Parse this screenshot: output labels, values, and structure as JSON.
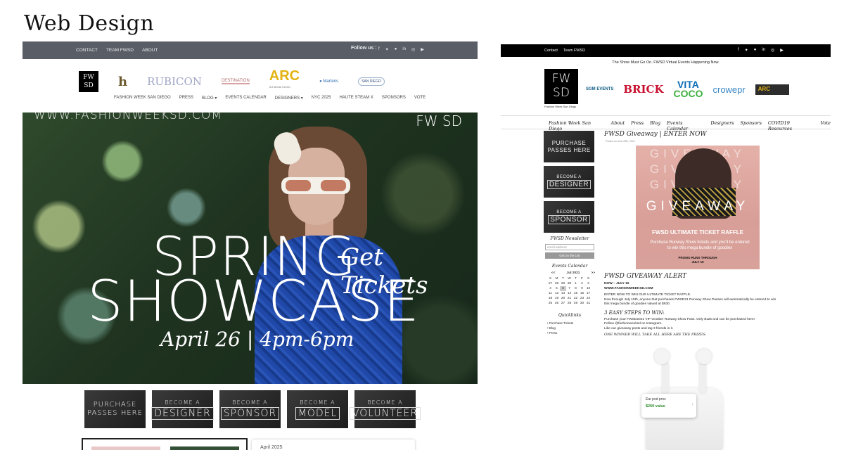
{
  "page_heading": "Web Design",
  "left_site": {
    "topbar": {
      "nav": [
        "CONTACT",
        "TEAM FWSD",
        "ABOUT"
      ],
      "follow_label": "Follow us :",
      "social_icons": [
        "facebook-icon",
        "twitter-icon",
        "pinterest-icon",
        "linkedin-icon",
        "instagram-icon",
        "youtube-icon"
      ]
    },
    "logos": {
      "fwsd": "FW SD",
      "h": "h",
      "rubicon": "RUBICON",
      "destination": "DESTINATION",
      "arc": "ARC",
      "arc_sub": "Art Media Center",
      "martens": "● Martens",
      "sandiego": "SAN DIEGO"
    },
    "nav": [
      "FASHION WEEK SAN DIEGO",
      "PRESS",
      "BLOG ▾",
      "EVENTS CALENDAR",
      "DESIGNERS ▾",
      "NYC 2025",
      "HAUTE STEAM X",
      "SPONSORS",
      "VOTE"
    ],
    "hero": {
      "url": "WWW.FASHIONWEEKSD.COM",
      "fwsd": "FW SD",
      "line1": "SPRING",
      "line2": "SHOWCASE",
      "script": "Get Tickets",
      "date": "April 26 | 4pm-6pm"
    },
    "tiles": {
      "purchase": "PURCHASE PASSES HERE",
      "designer_small": "BECOME A",
      "designer_big": "DESIGNER",
      "sponsor_small": "BECOME A",
      "sponsor_big": "SPONSOR",
      "model_small": "BECOME A",
      "model_big": "MODEL",
      "volunteer_small": "BECOME A",
      "volunteer_big": "VOLUNTEER"
    },
    "bottom_card_text": "April 2025"
  },
  "right_site": {
    "topbar": {
      "nav": [
        "Contact",
        "Team FWSD"
      ],
      "social_icons": [
        "facebook-icon",
        "twitter-icon",
        "pinterest-icon",
        "linkedin-icon",
        "instagram-icon",
        "youtube-icon"
      ]
    },
    "tagline": "The Show Must Go On. FWSD Virtual Events Happening Now.",
    "fwsd_logo": "FW SD",
    "fwsd_caption": "Fashion Week San Diego",
    "sponsors": {
      "sgm": "SGM EVENTS",
      "brick": "BRICK",
      "vita": "VITA",
      "coco": "COCO",
      "crowe": "crowepr",
      "arc": "ARC"
    },
    "nav": [
      "Fashion Week San Diego",
      "About",
      "Press",
      "Blog",
      "Events Calendar",
      "Designers",
      "Sponsors",
      "COVID19 Resources",
      "Vote"
    ],
    "sidebar": {
      "purchase": "PURCHASE PASSES HERE",
      "designer_small": "BECOME A",
      "designer_big": "DESIGNER",
      "sponsor_small": "BECOME A",
      "sponsor_big": "SPONSOR",
      "newsletter_heading": "FWSD Newsletter",
      "email_placeholder": "email address",
      "list_button": "Get on the List",
      "calendar_heading": "Events Calendar",
      "calendar": {
        "prev": "<<",
        "month": "Jul 2021",
        "next": ">>",
        "weekdays": [
          "S",
          "M",
          "T",
          "W",
          "T",
          "F",
          "S"
        ],
        "weeks": [
          [
            "27",
            "28",
            "29",
            "30",
            "1",
            "2",
            "3"
          ],
          [
            "4",
            "5",
            "6",
            "7",
            "8",
            "9",
            "10"
          ],
          [
            "11",
            "12",
            "13",
            "14",
            "15",
            "16",
            "17"
          ],
          [
            "18",
            "19",
            "20",
            "21",
            "22",
            "23",
            "24"
          ],
          [
            "25",
            "26",
            "27",
            "28",
            "29",
            "30",
            "31"
          ]
        ],
        "today": "6"
      },
      "quicklinks_heading": "Quicklinks",
      "quicklinks": [
        "• Purchase Tickets",
        "• Blog",
        "• Press"
      ]
    },
    "post": {
      "title": "FWSD Giveaway | ENTER NOW",
      "posted": "Posted on June 29th, 2021",
      "banner": {
        "watermark": "GIVEAWAY",
        "raffle": "FWSD ULTIMATE TICKET RAFFLE",
        "body": "Purchase Runway Show tickets and you'll be entered to win this mega bundle of goodies",
        "promo1": "PROMO RUNS THROUGH",
        "promo2": "JULY 15"
      },
      "alert_heading": "FWSD GIVEAWAY ALERT",
      "dates_line": "NOW – JULY 15",
      "website": "WWW.FASHIONWEEKSD.COM",
      "para1": "ENTER NOW TO WIN OUR ULTIMATE TICKET RAFFLE.",
      "para2": "Now through July 15th, anyone that purchases FWSD21 Runway Show Passes will automatically be entered to win this mega bundle of goodies valued at $930.",
      "steps_heading": "3 EASY STEPS TO WIN:",
      "step1": "Purchase your FWSD2021 VIP October Runway Show Pass. Only $125 and can be purchased here!",
      "step2": "Follow @fashionweeksd on Instagram.",
      "step3": "Like our giveaway posts and tag 3 friends in it.",
      "winner": "ONE WINNER WILL TAKE ALL HERE ARE THE PRIZES:",
      "prize_name": "Ear pod pros",
      "prize_value": "$250 value"
    }
  }
}
